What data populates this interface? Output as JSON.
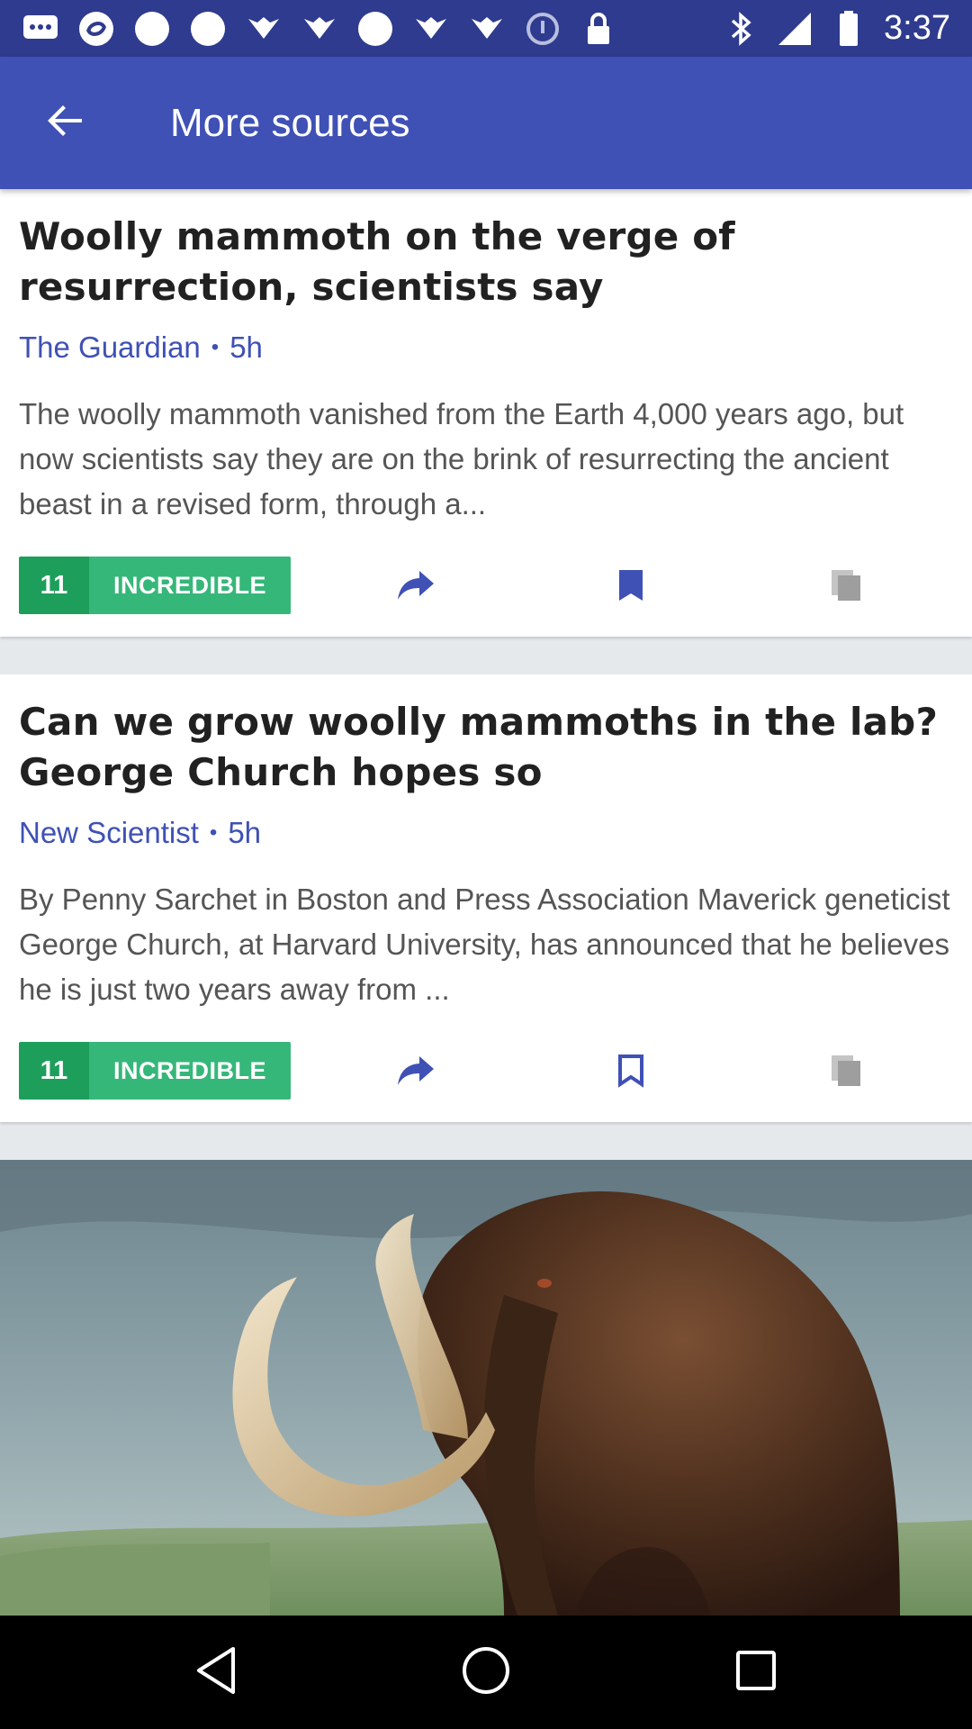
{
  "status_bar": {
    "time": "3:37",
    "left_icons": [
      "messaging-icon",
      "sync-icon",
      "circle-icon",
      "circle-icon",
      "wings-icon",
      "wings-icon",
      "circle-icon",
      "wings-icon",
      "wings-icon",
      "data-saver-icon",
      "lock-icon"
    ],
    "right_icons": [
      "bluetooth-icon",
      "signal-icon",
      "battery-icon"
    ]
  },
  "app_bar": {
    "title": "More sources",
    "back_icon": "arrow-back-icon"
  },
  "articles": [
    {
      "title": "Woolly mammoth on the verge of resurrection, scientists say",
      "source": "The Guardian",
      "separator": "•",
      "age": "5h",
      "snippet": "The woolly mammoth vanished from the Earth 4,000 years ago, but now scientists say they are on the brink of resurrecting the ancient beast in a revised form, through a...",
      "reaction_count": "11",
      "reaction_label": "INCREDIBLE",
      "bookmarked": true
    },
    {
      "title": "Can we grow woolly mammoths in the lab? George Church hopes so",
      "source": "New Scientist",
      "separator": "•",
      "age": "5h",
      "snippet": "By Penny Sarchet in Boston and Press Association Maverick geneticist George Church, at Harvard University, has announced that he believes he is just two years away from ...",
      "reaction_count": "11",
      "reaction_label": "INCREDIBLE",
      "bookmarked": false
    }
  ],
  "colors": {
    "status_bar": "#2f3b8e",
    "app_bar": "#3f51b5",
    "accent": "#3f51b5",
    "reaction_dark": "#1e9e5b",
    "reaction_light": "#36b77a"
  }
}
